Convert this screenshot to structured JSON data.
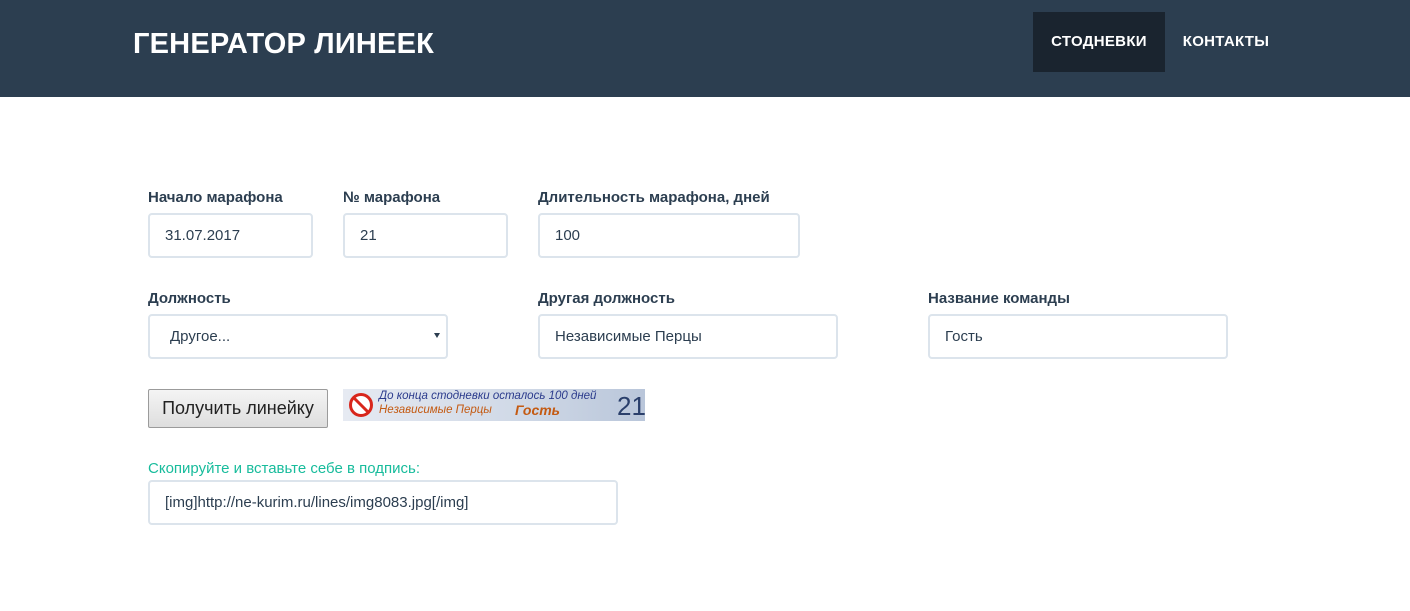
{
  "header": {
    "brand": "ГЕНЕРАТОР ЛИНЕЕК",
    "nav": [
      {
        "label": "СТОДНЕВКИ",
        "active": true
      },
      {
        "label": "КОНТАКТЫ",
        "active": false
      }
    ]
  },
  "form": {
    "start": {
      "label": "Начало марафона",
      "value": "31.07.2017"
    },
    "number": {
      "label": "№ марафона",
      "value": "21"
    },
    "duration": {
      "label": "Длительность марафона, дней",
      "value": "100"
    },
    "position": {
      "label": "Должность",
      "selected": "Другое..."
    },
    "other_position": {
      "label": "Другая должность",
      "value": "Независимые Перцы"
    },
    "team": {
      "label": "Название команды",
      "value": "Гость"
    },
    "submit_label": "Получить линейку"
  },
  "banner": {
    "line1": "До конца стодневки осталось 100 дней",
    "line2_left": "Независимые Перцы",
    "line2_right": "Гость",
    "number": "21",
    "icon": "no-sign-icon"
  },
  "copy": {
    "hint": "Скопируйте и вставьте себе в подпись:",
    "code": "[img]http://ne-kurim.ru/lines/img8083.jpg[/img]"
  },
  "colors": {
    "navbar": "#2c3e50",
    "nav_active": "#1a242f",
    "accent": "#18bc9c",
    "input_border": "#dce4ec"
  }
}
